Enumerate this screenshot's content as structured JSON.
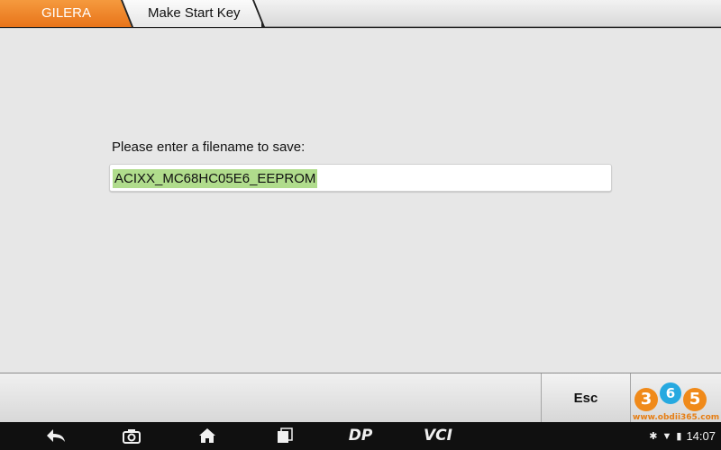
{
  "breadcrumb": {
    "brand": "GILERA",
    "page": "Make Start Key"
  },
  "dialog": {
    "prompt": "Please enter a filename to save:",
    "filename_value": "ACIXX_MC68HC05E6_EEPROM"
  },
  "footer": {
    "esc_label": "Esc"
  },
  "watermark": {
    "digits": [
      "3",
      "6",
      "5"
    ],
    "url": "www.obdii365.com"
  },
  "nav": {
    "dp_label": "DP",
    "vci_label": "VCI"
  },
  "status": {
    "time": "14:07"
  },
  "colors": {
    "brand_tab": "#e8741a",
    "selection": "#b0dc8c",
    "content_bg": "#e7e7e7"
  }
}
